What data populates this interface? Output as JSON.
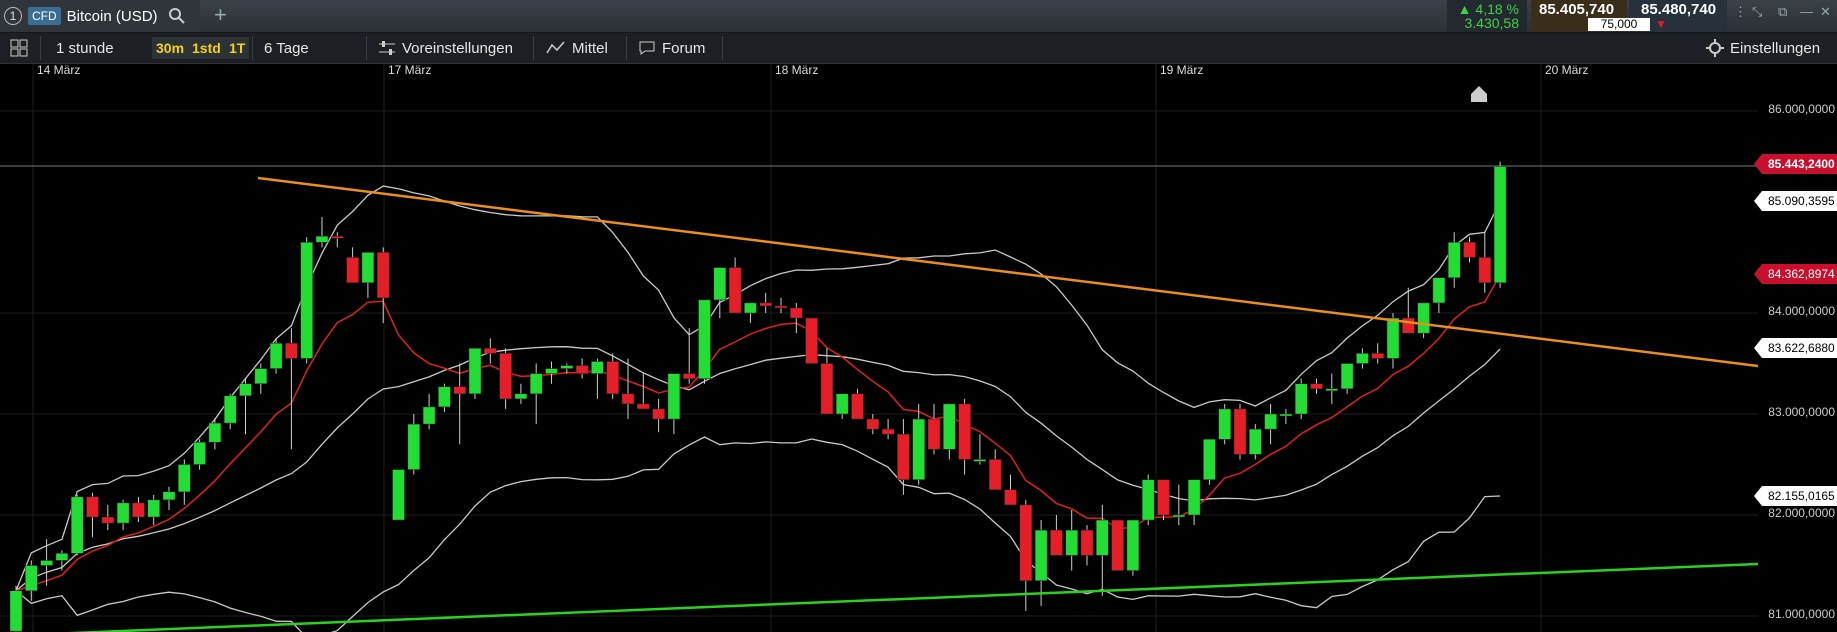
{
  "tab": {
    "number": "1",
    "badge": "CFD",
    "title": "Bitcoin (USD)"
  },
  "quote": {
    "change_pct": "4,18 %",
    "change_abs": "3.430,58",
    "bid": "85.405,740",
    "ask": "85.480,740",
    "spread": "75,000"
  },
  "toolbar": {
    "interval": "1 stunde",
    "timeframes": [
      "30m",
      "1std",
      "1T"
    ],
    "range": "6 Tage",
    "presets": "Voreinstellungen",
    "indicator": "Mittel",
    "forum": "Forum",
    "settings": "Einstellungen"
  },
  "dates": [
    "14 März",
    "17 März",
    "18 März",
    "19 März",
    "20 März"
  ],
  "price_axis": [
    "86.000,0000",
    "84.000,0000",
    "83.000,0000",
    "82.000,0000",
    "81.000,0000"
  ],
  "price_tags": {
    "current": "85.443,2400",
    "upper_band": "85.090,3595",
    "ma": "84.362,8974",
    "mid_band": "83.622,6880",
    "lower_band": "82.155,0165"
  },
  "colors": {
    "up": "#22dd33",
    "down": "#e61e28",
    "trend_resistance": "#e8901a",
    "trend_support": "#2ad21f",
    "ma": "#e02020",
    "bands": "#c9c9c9"
  },
  "chart_data": {
    "type": "candlestick",
    "ylim": [
      80950,
      86300
    ],
    "candles": [
      [
        80850,
        81300,
        80750,
        81250
      ],
      [
        81250,
        81550,
        81150,
        81500
      ],
      [
        81500,
        81760,
        81300,
        81550
      ],
      [
        81550,
        81650,
        81450,
        81620
      ],
      [
        81620,
        82200,
        81600,
        82180
      ],
      [
        82180,
        82220,
        81780,
        81980
      ],
      [
        81980,
        82100,
        81850,
        81920
      ],
      [
        81920,
        82150,
        81850,
        82120
      ],
      [
        82120,
        82180,
        81930,
        81980
      ],
      [
        81980,
        82200,
        81900,
        82150
      ],
      [
        82150,
        82280,
        82050,
        82230
      ],
      [
        82230,
        82550,
        82100,
        82500
      ],
      [
        82500,
        82750,
        82450,
        82720
      ],
      [
        82720,
        82960,
        82650,
        82910
      ],
      [
        82910,
        83200,
        82850,
        83180
      ],
      [
        83180,
        83350,
        82800,
        83300
      ],
      [
        83300,
        83500,
        83200,
        83450
      ],
      [
        83450,
        83750,
        83400,
        83700
      ],
      [
        83700,
        83850,
        82650,
        83550
      ],
      [
        83550,
        84750,
        83500,
        84700
      ],
      [
        84700,
        84950,
        84650,
        84760
      ],
      [
        84760,
        84800,
        84650,
        84750
      ],
      [
        84550,
        84650,
        84300,
        84300
      ],
      [
        84300,
        84600,
        84150,
        84600
      ],
      [
        84600,
        84650,
        83900,
        84150
      ],
      [
        81950,
        82400,
        81950,
        82450
      ],
      [
        82450,
        83000,
        82400,
        82900
      ],
      [
        82900,
        83200,
        82850,
        83070
      ],
      [
        83070,
        83300,
        83020,
        83270
      ],
      [
        83270,
        83500,
        82700,
        83200
      ],
      [
        83200,
        83600,
        83150,
        83650
      ],
      [
        83650,
        83750,
        83500,
        83600
      ],
      [
        83600,
        83650,
        83050,
        83150
      ],
      [
        83150,
        83300,
        83100,
        83200
      ],
      [
        83200,
        83500,
        82900,
        83400
      ],
      [
        83400,
        83520,
        83300,
        83450
      ],
      [
        83450,
        83500,
        83400,
        83480
      ],
      [
        83480,
        83550,
        83350,
        83400
      ],
      [
        83400,
        83550,
        83150,
        83520
      ],
      [
        83520,
        83600,
        83150,
        83200
      ],
      [
        83200,
        83550,
        82950,
        83100
      ],
      [
        83100,
        83400,
        83050,
        83050
      ],
      [
        83050,
        83150,
        82820,
        82950
      ],
      [
        82950,
        83400,
        82800,
        83400
      ],
      [
        83400,
        83850,
        83300,
        83350
      ],
      [
        83350,
        84100,
        83300,
        84130
      ],
      [
        84130,
        84450,
        83950,
        84450
      ],
      [
        84450,
        84550,
        84000,
        84000
      ],
      [
        84000,
        84100,
        83900,
        84100
      ],
      [
        84100,
        84200,
        84000,
        84070
      ],
      [
        84070,
        84150,
        84000,
        84050
      ],
      [
        84050,
        84100,
        83800,
        83950
      ],
      [
        83950,
        83900,
        83550,
        83500
      ],
      [
        83500,
        83650,
        83000,
        83000
      ],
      [
        83000,
        83200,
        82950,
        83200
      ],
      [
        83200,
        83250,
        82950,
        82950
      ],
      [
        82950,
        83000,
        82800,
        82850
      ],
      [
        82850,
        82950,
        82750,
        82800
      ],
      [
        82800,
        82950,
        82200,
        82350
      ],
      [
        82350,
        83100,
        82300,
        82950
      ],
      [
        82950,
        83100,
        82600,
        82650
      ],
      [
        82650,
        83050,
        82550,
        83100
      ],
      [
        83100,
        83150,
        82400,
        82550
      ],
      [
        82550,
        82800,
        82500,
        82550
      ],
      [
        82550,
        82650,
        82250,
        82250
      ],
      [
        82250,
        82400,
        82100,
        82100
      ],
      [
        82100,
        82150,
        81050,
        81350
      ],
      [
        81350,
        81950,
        81100,
        81850
      ],
      [
        81850,
        82000,
        81700,
        81600
      ],
      [
        81600,
        82050,
        81450,
        81850
      ],
      [
        81850,
        81900,
        81500,
        81600
      ],
      [
        81600,
        82100,
        81200,
        81950
      ],
      [
        81950,
        81800,
        81450,
        81450
      ],
      [
        81450,
        81950,
        81400,
        81950
      ],
      [
        81950,
        82400,
        81900,
        82350
      ],
      [
        82350,
        82250,
        81950,
        82000
      ],
      [
        82000,
        82300,
        81900,
        82000
      ],
      [
        82000,
        82350,
        81900,
        82350
      ],
      [
        82350,
        82750,
        82300,
        82750
      ],
      [
        82750,
        83100,
        82700,
        83050
      ],
      [
        83050,
        83100,
        82550,
        82600
      ],
      [
        82600,
        82900,
        82550,
        82850
      ],
      [
        82850,
        83100,
        82700,
        83000
      ],
      [
        83000,
        83050,
        82900,
        83000
      ],
      [
        83000,
        83350,
        82950,
        83300
      ],
      [
        83300,
        83350,
        83200,
        83250
      ],
      [
        83250,
        83400,
        83100,
        83250
      ],
      [
        83250,
        83500,
        83200,
        83500
      ],
      [
        83500,
        83650,
        83450,
        83600
      ],
      [
        83600,
        83700,
        83500,
        83550
      ],
      [
        83550,
        84000,
        83450,
        83950
      ],
      [
        83950,
        84250,
        83850,
        83800
      ],
      [
        83800,
        84100,
        83750,
        84100
      ],
      [
        84100,
        84350,
        84000,
        84350
      ],
      [
        84350,
        84800,
        84250,
        84700
      ],
      [
        84700,
        84750,
        84500,
        84550
      ],
      [
        84550,
        84800,
        84200,
        84300
      ],
      [
        84300,
        85500,
        84250,
        85450
      ]
    ]
  }
}
